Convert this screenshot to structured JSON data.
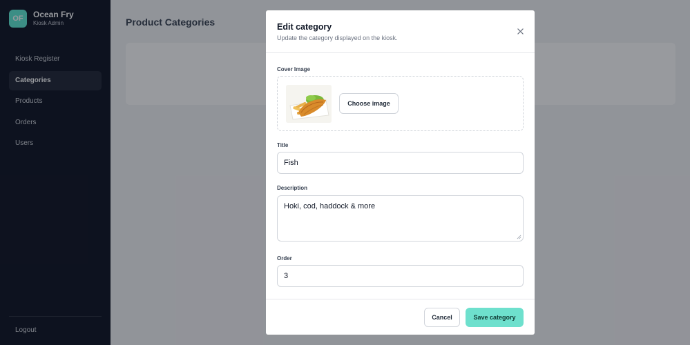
{
  "sidebar": {
    "brand": {
      "logo": "OF",
      "name": "Ocean Fry",
      "subtitle": "Kiosk Admin",
      "accent_color": "#5eead4"
    },
    "items": [
      {
        "label": "Kiosk Register"
      },
      {
        "label": "Categories",
        "active": true
      },
      {
        "label": "Products"
      },
      {
        "label": "Orders"
      },
      {
        "label": "Users"
      }
    ],
    "logout_label": "Logout"
  },
  "main": {
    "title": "Product Categories"
  },
  "modal": {
    "title": "Edit category",
    "subtitle": "Update the category displayed on the kiosk.",
    "close_icon": "close-icon",
    "cover": {
      "label": "Cover Image",
      "choose_label": "Choose image",
      "thumbnail": "fish-and-chips"
    },
    "fields": {
      "title": {
        "label": "Title",
        "value": "Fish"
      },
      "description": {
        "label": "Description",
        "value": "Hoki, cod, haddock & more"
      },
      "order": {
        "label": "Order",
        "value": "3"
      }
    },
    "cancel_label": "Cancel",
    "save_label": "Save category",
    "save_color": "#6ee0cd"
  }
}
